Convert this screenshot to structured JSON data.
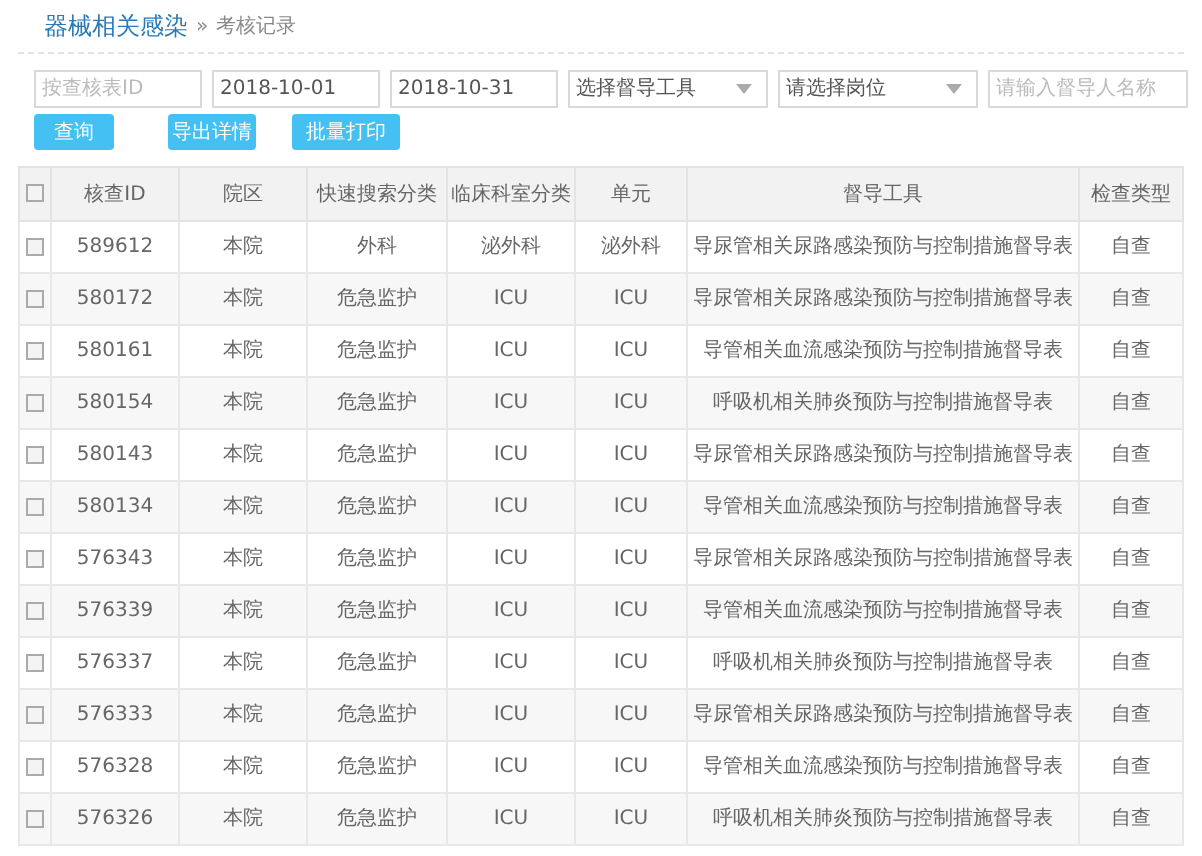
{
  "breadcrumb": {
    "title": "器械相关感染",
    "separator": "»",
    "current": "考核记录"
  },
  "filters": [
    {
      "kind": "text",
      "placeholder": "按查核表ID"
    },
    {
      "kind": "text",
      "value": "2018-10-01"
    },
    {
      "kind": "text",
      "value": "2018-10-31"
    },
    {
      "kind": "select",
      "value": "选择督导工具"
    },
    {
      "kind": "select",
      "value": "请选择岗位"
    },
    {
      "kind": "text",
      "placeholder": "请输入督导人名称"
    }
  ],
  "buttons": [
    "查询",
    "导出详情",
    "批量打印"
  ],
  "table": {
    "select_all": {
      "checked": false
    },
    "columns": [
      "核查ID",
      "院区",
      "快速搜索分类",
      "临床科室分类",
      "单元",
      "督导工具",
      "检查类型"
    ],
    "rows": [
      {
        "checked": false,
        "cells": [
          "589612",
          "本院",
          "外科",
          "泌外科",
          "泌外科",
          "导尿管相关尿路感染预防与控制措施督导表",
          "自查"
        ]
      },
      {
        "checked": false,
        "cells": [
          "580172",
          "本院",
          "危急监护",
          "ICU",
          "ICU",
          "导尿管相关尿路感染预防与控制措施督导表",
          "自查"
        ]
      },
      {
        "checked": false,
        "cells": [
          "580161",
          "本院",
          "危急监护",
          "ICU",
          "ICU",
          "导管相关血流感染预防与控制措施督导表",
          "自查"
        ]
      },
      {
        "checked": false,
        "cells": [
          "580154",
          "本院",
          "危急监护",
          "ICU",
          "ICU",
          "呼吸机相关肺炎预防与控制措施督导表",
          "自查"
        ]
      },
      {
        "checked": false,
        "cells": [
          "580143",
          "本院",
          "危急监护",
          "ICU",
          "ICU",
          "导尿管相关尿路感染预防与控制措施督导表",
          "自查"
        ]
      },
      {
        "checked": false,
        "cells": [
          "580134",
          "本院",
          "危急监护",
          "ICU",
          "ICU",
          "导管相关血流感染预防与控制措施督导表",
          "自查"
        ]
      },
      {
        "checked": false,
        "cells": [
          "576343",
          "本院",
          "危急监护",
          "ICU",
          "ICU",
          "导尿管相关尿路感染预防与控制措施督导表",
          "自查"
        ]
      },
      {
        "checked": false,
        "cells": [
          "576339",
          "本院",
          "危急监护",
          "ICU",
          "ICU",
          "导管相关血流感染预防与控制措施督导表",
          "自查"
        ]
      },
      {
        "checked": false,
        "cells": [
          "576337",
          "本院",
          "危急监护",
          "ICU",
          "ICU",
          "呼吸机相关肺炎预防与控制措施督导表",
          "自查"
        ]
      },
      {
        "checked": false,
        "cells": [
          "576333",
          "本院",
          "危急监护",
          "ICU",
          "ICU",
          "导尿管相关尿路感染预防与控制措施督导表",
          "自查"
        ]
      },
      {
        "checked": false,
        "cells": [
          "576328",
          "本院",
          "危急监护",
          "ICU",
          "ICU",
          "导管相关血流感染预防与控制措施督导表",
          "自查"
        ]
      },
      {
        "checked": false,
        "cells": [
          "576326",
          "本院",
          "危急监护",
          "ICU",
          "ICU",
          "呼吸机相关肺炎预防与控制措施督导表",
          "自查"
        ]
      }
    ]
  }
}
